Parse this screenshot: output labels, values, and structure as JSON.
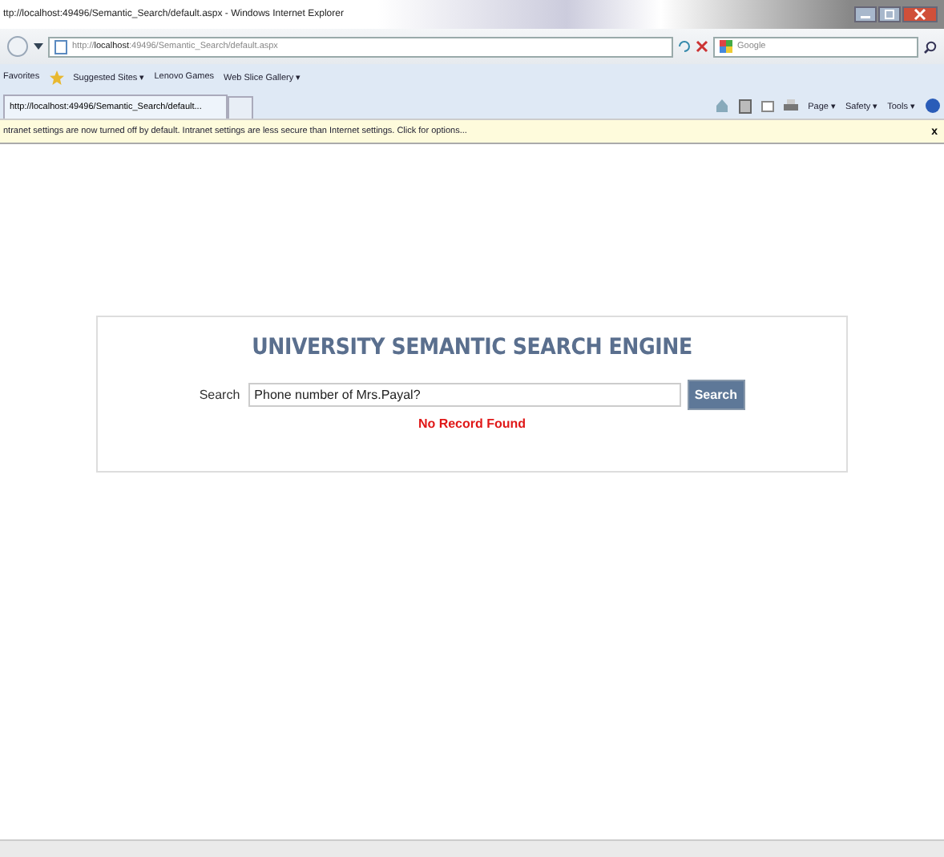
{
  "window": {
    "title": "ttp://localhost:49496/Semantic_Search/default.aspx - Windows Internet Explorer"
  },
  "address_bar": {
    "url_prefix": "http://",
    "url_host": "localhost",
    "url_rest": ":49496/Semantic_Search/default.aspx"
  },
  "search_box": {
    "placeholder": "Google"
  },
  "favorites_bar": {
    "label": "Favorites",
    "items": [
      {
        "label": "Suggested Sites ▾"
      },
      {
        "label": "Lenovo Games"
      },
      {
        "label": "Web Slice Gallery ▾"
      }
    ]
  },
  "tabs": [
    {
      "label": "http://localhost:49496/Semantic_Search/default...",
      "selected": true
    }
  ],
  "command_bar": {
    "items": [
      {
        "label": "Page ▾"
      },
      {
        "label": "Safety ▾"
      },
      {
        "label": "Tools ▾"
      }
    ]
  },
  "info_bar": {
    "message": "ntranet settings are now turned off by default. Intranet settings are less secure than Internet settings. Click for options...",
    "close": "x"
  },
  "page": {
    "heading": "UNIVERSITY SEMANTIC SEARCH ENGINE",
    "search_label": "Search",
    "search_value": "Phone number of Mrs.Payal?",
    "button": "Search",
    "message": "No Record Found"
  }
}
